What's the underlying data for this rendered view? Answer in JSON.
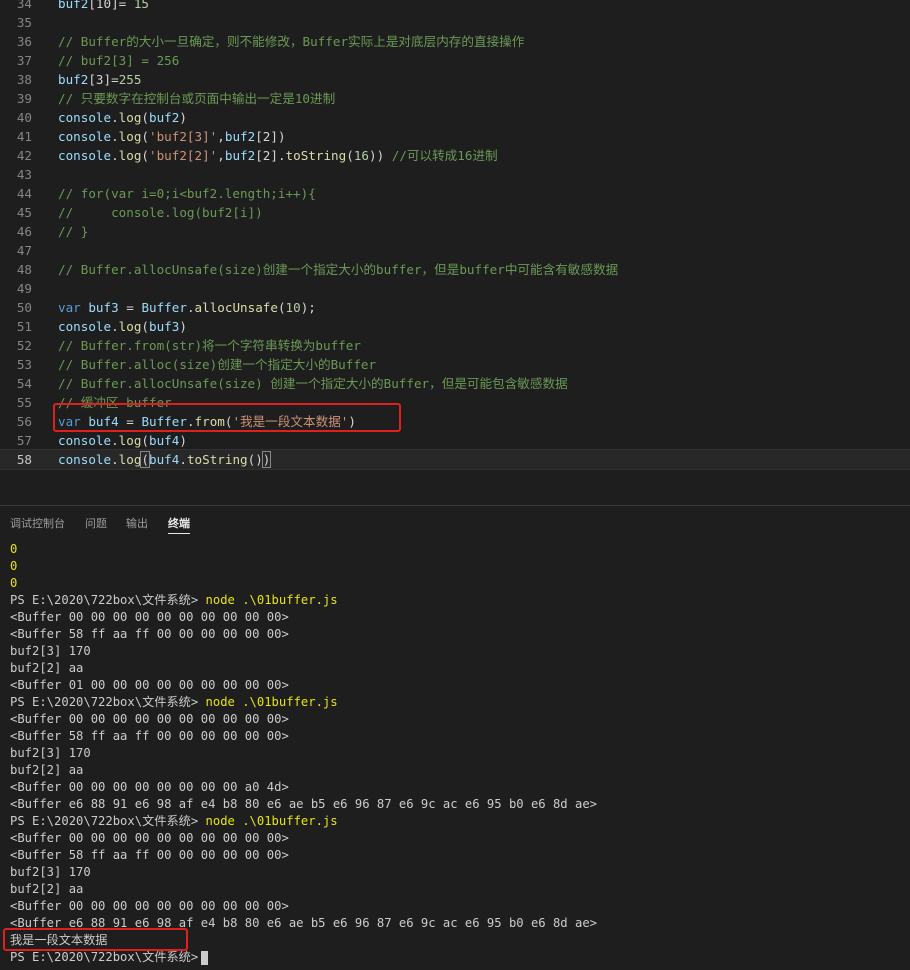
{
  "editor": {
    "lines": [
      {
        "n": "34",
        "tokens": [
          {
            "c": "var",
            "t": "buf2"
          },
          {
            "c": "pun",
            "t": "[10]= "
          },
          {
            "c": "num",
            "t": "15"
          }
        ]
      },
      {
        "n": "35",
        "tokens": []
      },
      {
        "n": "36",
        "tokens": [
          {
            "c": "cm",
            "t": "// Buffer的大小一旦确定，则不能修改，Buffer实际上是对底层内存的直接操作"
          }
        ]
      },
      {
        "n": "37",
        "tokens": [
          {
            "c": "cm",
            "t": "// buf2[3] = 256"
          }
        ]
      },
      {
        "n": "38",
        "tokens": [
          {
            "c": "var",
            "t": "buf2"
          },
          {
            "c": "pun",
            "t": "[3]="
          },
          {
            "c": "num",
            "t": "255"
          }
        ]
      },
      {
        "n": "39",
        "tokens": [
          {
            "c": "cm",
            "t": "// 只要数字在控制台或页面中输出一定是10进制"
          }
        ]
      },
      {
        "n": "40",
        "tokens": [
          {
            "c": "var",
            "t": "console"
          },
          {
            "c": "pun",
            "t": "."
          },
          {
            "c": "fn",
            "t": "log"
          },
          {
            "c": "pun",
            "t": "("
          },
          {
            "c": "var",
            "t": "buf2"
          },
          {
            "c": "pun",
            "t": ")"
          }
        ]
      },
      {
        "n": "41",
        "tokens": [
          {
            "c": "var",
            "t": "console"
          },
          {
            "c": "pun",
            "t": "."
          },
          {
            "c": "fn",
            "t": "log"
          },
          {
            "c": "pun",
            "t": "("
          },
          {
            "c": "str",
            "t": "'buf2[3]'"
          },
          {
            "c": "pun",
            "t": ","
          },
          {
            "c": "var",
            "t": "buf2"
          },
          {
            "c": "pun",
            "t": "[2])"
          }
        ]
      },
      {
        "n": "42",
        "tokens": [
          {
            "c": "var",
            "t": "console"
          },
          {
            "c": "pun",
            "t": "."
          },
          {
            "c": "fn",
            "t": "log"
          },
          {
            "c": "pun",
            "t": "("
          },
          {
            "c": "str",
            "t": "'buf2[2]'"
          },
          {
            "c": "pun",
            "t": ","
          },
          {
            "c": "var",
            "t": "buf2"
          },
          {
            "c": "pun",
            "t": "[2]."
          },
          {
            "c": "fn",
            "t": "toString"
          },
          {
            "c": "pun",
            "t": "("
          },
          {
            "c": "num",
            "t": "16"
          },
          {
            "c": "pun",
            "t": ")) "
          },
          {
            "c": "cm",
            "t": "//可以转成16进制"
          }
        ]
      },
      {
        "n": "43",
        "tokens": []
      },
      {
        "n": "44",
        "tokens": [
          {
            "c": "cm",
            "t": "// for(var i=0;i<buf2.length;i++){"
          }
        ]
      },
      {
        "n": "45",
        "tokens": [
          {
            "c": "cm",
            "t": "//     console.log(buf2[i])"
          }
        ]
      },
      {
        "n": "46",
        "tokens": [
          {
            "c": "cm",
            "t": "// }"
          }
        ]
      },
      {
        "n": "47",
        "tokens": []
      },
      {
        "n": "48",
        "tokens": [
          {
            "c": "cm",
            "t": "// Buffer.allocUnsafe(size)创建一个指定大小的buffer，但是buffer中可能含有敏感数据"
          }
        ]
      },
      {
        "n": "49",
        "tokens": []
      },
      {
        "n": "50",
        "tokens": [
          {
            "c": "kw",
            "t": "var"
          },
          {
            "c": "pun",
            "t": " "
          },
          {
            "c": "var",
            "t": "buf3"
          },
          {
            "c": "pun",
            "t": " = "
          },
          {
            "c": "var",
            "t": "Buffer"
          },
          {
            "c": "pun",
            "t": "."
          },
          {
            "c": "fn",
            "t": "allocUnsafe"
          },
          {
            "c": "pun",
            "t": "("
          },
          {
            "c": "num",
            "t": "10"
          },
          {
            "c": "pun",
            "t": ");"
          }
        ]
      },
      {
        "n": "51",
        "tokens": [
          {
            "c": "var",
            "t": "console"
          },
          {
            "c": "pun",
            "t": "."
          },
          {
            "c": "fn",
            "t": "log"
          },
          {
            "c": "pun",
            "t": "("
          },
          {
            "c": "var",
            "t": "buf3"
          },
          {
            "c": "pun",
            "t": ")"
          }
        ]
      },
      {
        "n": "52",
        "tokens": [
          {
            "c": "cm",
            "t": "// Buffer.from(str)将一个字符串转换为buffer"
          }
        ]
      },
      {
        "n": "53",
        "tokens": [
          {
            "c": "cm",
            "t": "// Buffer.alloc(size)创建一个指定大小的Buffer"
          }
        ]
      },
      {
        "n": "54",
        "tokens": [
          {
            "c": "cm",
            "t": "// Buffer.allocUnsafe(size) 创建一个指定大小的Buffer，但是可能包含敏感数据"
          }
        ]
      },
      {
        "n": "55",
        "tokens": [
          {
            "c": "cm",
            "t": "// 缓冲区 buffer"
          }
        ]
      },
      {
        "n": "56",
        "tokens": [
          {
            "c": "kw",
            "t": "var"
          },
          {
            "c": "pun",
            "t": " "
          },
          {
            "c": "var",
            "t": "buf4"
          },
          {
            "c": "pun",
            "t": " = "
          },
          {
            "c": "var",
            "t": "Buffer"
          },
          {
            "c": "pun",
            "t": "."
          },
          {
            "c": "fn",
            "t": "from"
          },
          {
            "c": "pun",
            "t": "("
          },
          {
            "c": "str",
            "t": "'我是一段文本数据'"
          },
          {
            "c": "pun",
            "t": ")"
          }
        ]
      },
      {
        "n": "57",
        "tokens": [
          {
            "c": "var",
            "t": "console"
          },
          {
            "c": "pun",
            "t": "."
          },
          {
            "c": "fn",
            "t": "log"
          },
          {
            "c": "pun",
            "t": "("
          },
          {
            "c": "var",
            "t": "buf4"
          },
          {
            "c": "pun",
            "t": ")"
          }
        ]
      },
      {
        "n": "58",
        "current": true,
        "tokens": [
          {
            "c": "var",
            "t": "console"
          },
          {
            "c": "pun",
            "t": "."
          },
          {
            "c": "fn",
            "t": "log"
          },
          {
            "c": "br",
            "t": "("
          },
          {
            "c": "var",
            "t": "buf4"
          },
          {
            "c": "pun",
            "t": "."
          },
          {
            "c": "fn",
            "t": "toString"
          },
          {
            "c": "pun",
            "t": "()"
          },
          {
            "c": "br",
            "t": ")"
          }
        ]
      }
    ]
  },
  "panel": {
    "tabs": [
      {
        "label": "调试控制台",
        "active": false
      },
      {
        "label": "问题",
        "active": false
      },
      {
        "label": "输出",
        "active": false
      },
      {
        "label": "终端",
        "active": true
      }
    ]
  },
  "terminal": {
    "prompt": "PS E:\\2020\\722box\\文件系统>",
    "lines": [
      {
        "text": "0",
        "style": "yellow"
      },
      {
        "text": "0",
        "style": "yellow"
      },
      {
        "text": "0",
        "style": "yellow"
      },
      {
        "cmd": "node .\\01buffer.js"
      },
      {
        "text": "<Buffer 00 00 00 00 00 00 00 00 00 00>"
      },
      {
        "text": "<Buffer 58 ff aa ff 00 00 00 00 00 00>"
      },
      {
        "text": "buf2[3] 170"
      },
      {
        "text": "buf2[2] aa"
      },
      {
        "text": "<Buffer 01 00 00 00 00 00 00 00 00 00>"
      },
      {
        "cmd": "node .\\01buffer.js"
      },
      {
        "text": "<Buffer 00 00 00 00 00 00 00 00 00 00>"
      },
      {
        "text": "<Buffer 58 ff aa ff 00 00 00 00 00 00>"
      },
      {
        "text": "buf2[3] 170"
      },
      {
        "text": "buf2[2] aa"
      },
      {
        "text": "<Buffer 00 00 00 00 00 00 00 00 a0 4d>"
      },
      {
        "text": "<Buffer e6 88 91 e6 98 af e4 b8 80 e6 ae b5 e6 96 87 e6 9c ac e6 95 b0 e6 8d ae>"
      },
      {
        "cmd": "node .\\01buffer.js"
      },
      {
        "text": "<Buffer 00 00 00 00 00 00 00 00 00 00>"
      },
      {
        "text": "<Buffer 58 ff aa ff 00 00 00 00 00 00>"
      },
      {
        "text": "buf2[3] 170"
      },
      {
        "text": "buf2[2] aa"
      },
      {
        "text": "<Buffer 00 00 00 00 00 00 00 00 00 00>"
      },
      {
        "text": "<Buffer e6 88 91 e6 98 af e4 b8 80 e6 ae b5 e6 96 87 e6 9c ac e6 95 b0 e6 8d ae>"
      },
      {
        "text": "我是一段文本数据"
      },
      {
        "cmd": "",
        "cursor": true
      }
    ]
  },
  "colors": {
    "highlight_box": "#e0201c",
    "terminal_yellow": "#e5e510"
  }
}
